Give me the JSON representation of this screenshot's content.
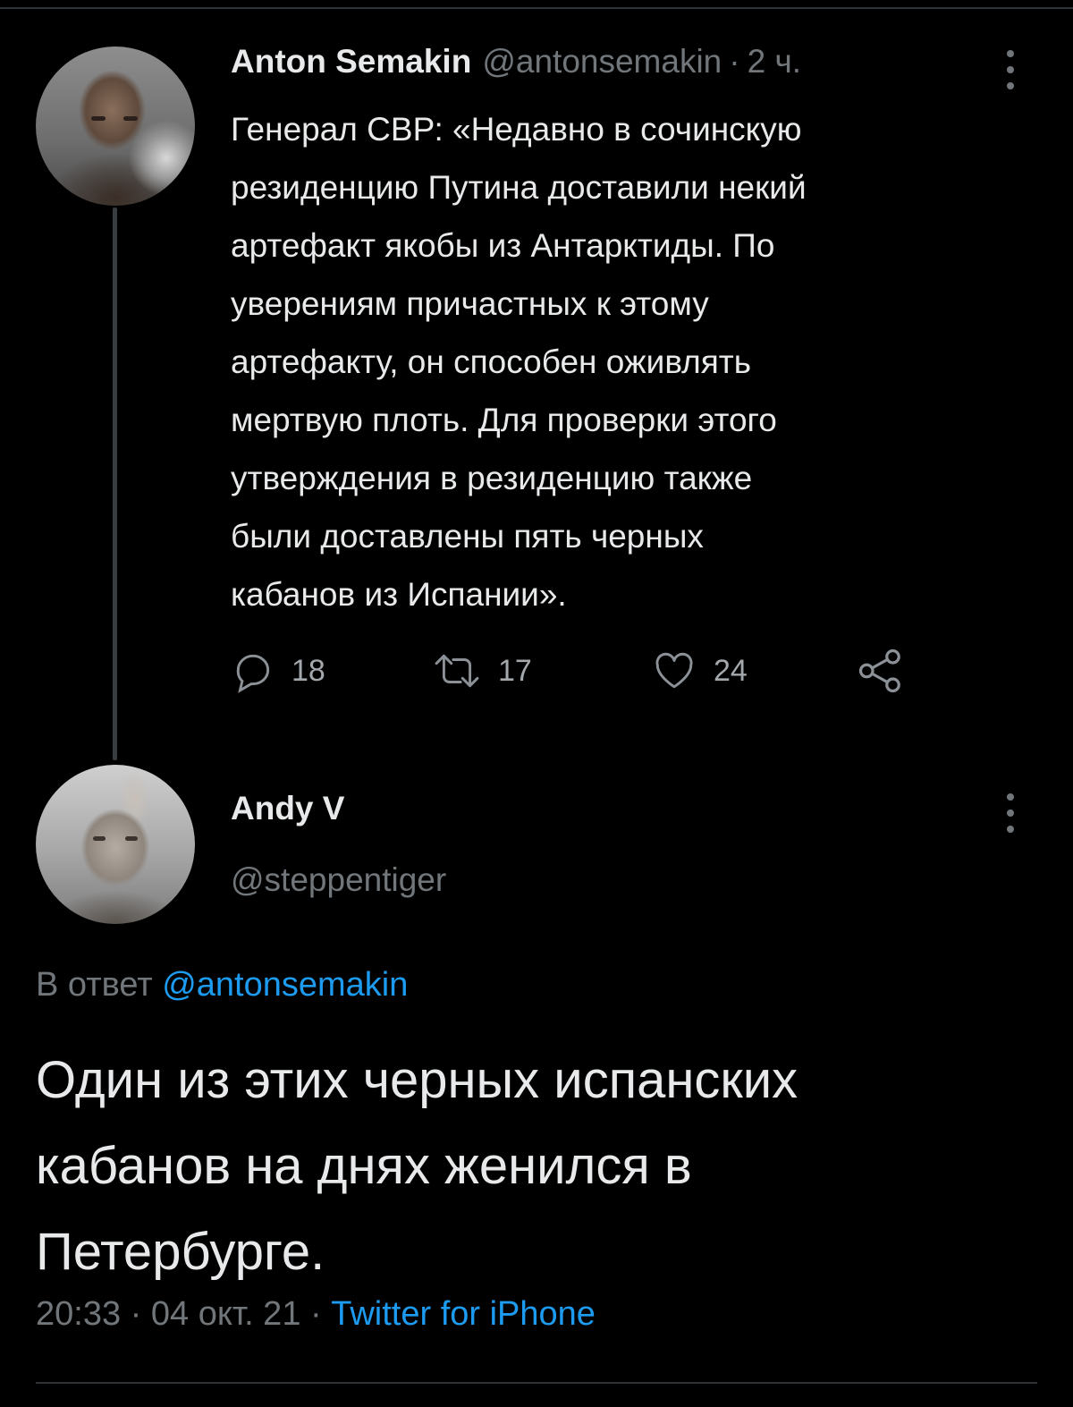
{
  "tweet1": {
    "name": "Anton Semakin",
    "handle": "@antonsemakin",
    "separator": "·",
    "time": "2 ч.",
    "text": "Генерал СВР: «Недавно в сочинскую\nрезиденцию Путина доставили некий\nартефакт якобы из Антарктиды. По\nуверениям причастных к этому\nартефакту, он способен оживлять\nмертвую плоть. Для проверки этого\nутверждения в резиденцию также\nбыли доставлены пять черных\nкабанов из Испании».",
    "actions": {
      "reply": {
        "icon": "reply-icon",
        "count": "18"
      },
      "retweet": {
        "icon": "retweet-icon",
        "count": "17"
      },
      "like": {
        "icon": "heart-icon",
        "count": "24"
      },
      "share": {
        "icon": "share-icon"
      }
    }
  },
  "tweet2": {
    "name": "Andy V",
    "handle": "@steppentiger",
    "reply_prefix": "В ответ",
    "reply_mention": "@antonsemakin",
    "text": "Один из этих черных испанских\nкабанов на днях женился в\nПетербурге.",
    "timestamp": "20:33 · 04 окт. 21 ·",
    "source": "Twitter for iPhone"
  },
  "colors": {
    "background": "#000000",
    "text": "#e7e9ea",
    "muted": "#71767b",
    "link": "#1d9bf0"
  }
}
